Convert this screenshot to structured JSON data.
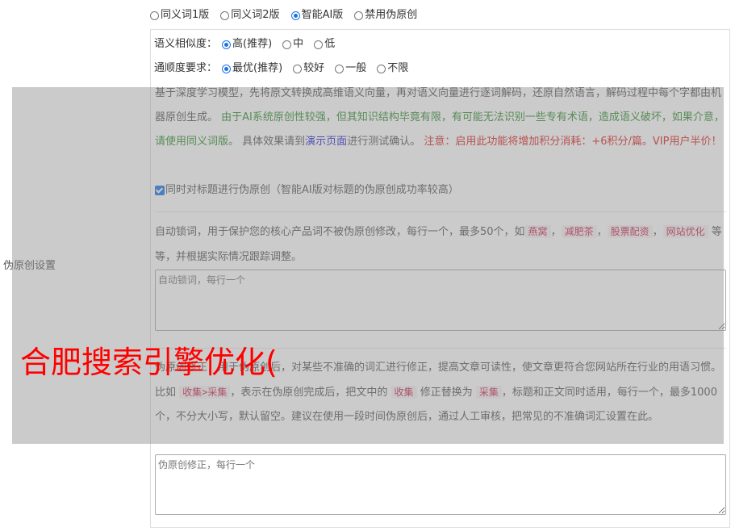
{
  "mode_options": [
    {
      "label": "同义词1版",
      "selected": false
    },
    {
      "label": "同义词2版",
      "selected": false
    },
    {
      "label": "智能AI版",
      "selected": true
    },
    {
      "label": "禁用伪原创",
      "selected": false
    }
  ],
  "similarity": {
    "label": "语义相似度：",
    "options": [
      {
        "label": "高(推荐)",
        "selected": true
      },
      {
        "label": "中",
        "selected": false
      },
      {
        "label": "低",
        "selected": false
      }
    ]
  },
  "fluency": {
    "label": "通顺度要求：",
    "options": [
      {
        "label": "最优(推荐)",
        "selected": true
      },
      {
        "label": "较好",
        "selected": false
      },
      {
        "label": "一般",
        "selected": false
      },
      {
        "label": "不限",
        "selected": false
      }
    ]
  },
  "ai_description": {
    "intro": "基于深度学习模型，先将原文转换成高维语义向量，再对语义向量进行逐词解码，还原自然语言，解码过程中每个字都由机器原创生成。",
    "warning_green": "由于AI系统原创性较强，但其知识结构毕竟有限，有可能无法识别一些专有术语，造成语义破坏，如果介意，请使用同义词版。",
    "test_prefix": "具体效果请到",
    "demo_link": "演示页面",
    "test_suffix": "进行测试确认。",
    "note_red": "注意：启用此功能将增加积分消耗：+6积分/篇。VIP用户半价！"
  },
  "title_checkbox": {
    "label": "同时对标题进行伪原创（智能AI版对标题的伪原创成功率较高）",
    "checked": true
  },
  "lock_words": {
    "desc_prefix": "自动锁词，用于保护您的核心产品词不被伪原创修改，每行一个，最多50个，如",
    "examples": [
      "燕窝",
      "减肥茶",
      "股票配资",
      "网站优化"
    ],
    "sep": "，",
    "desc_suffix": "等等，并根据实际情况跟踪调整。",
    "placeholder": "自动锁词，每行一个"
  },
  "correction": {
    "desc_a": "伪原创修正，用于伪原创后，对某些不准确的词汇进行修正，提高文章可读性，使文章更符合您网站所在行业的用语习惯。比如",
    "ex_rule": "收集>采集",
    "desc_b": "，表示在伪原创完成后，把文中的",
    "ex_from": "收集",
    "desc_c": "修正替换为",
    "ex_to": "采集",
    "desc_d": "，标题和正文同时适用，每行一个，最多1000个，不分大小写，默认留空。建议在使用一段时间伪原创后，通过人工审核，把常见的不准确词汇设置在此。",
    "placeholder": "伪原创修正，每行一个"
  },
  "side_label": "伪原创设置",
  "watermark": "合肥搜索引擎优化("
}
